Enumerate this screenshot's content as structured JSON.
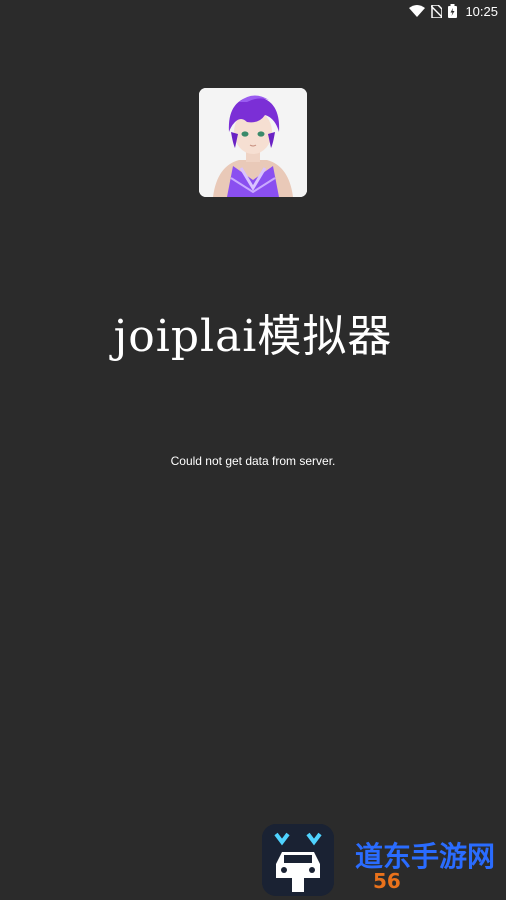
{
  "status_bar": {
    "time": "10:25",
    "icons": [
      "wifi-icon",
      "no-sim-icon",
      "battery-charging-icon"
    ]
  },
  "app": {
    "avatar": "anime-character-avatar",
    "title": "joiplai模拟器",
    "message": "Could not get data from server."
  },
  "footer": {
    "logo": "car-logo-icon",
    "watermark_text": "道东手游网"
  },
  "colors": {
    "background": "#2b2b2b",
    "text": "#ffffff",
    "avatar_hair": "#7b2fd6",
    "logo_bg": "#1a2233",
    "logo_accent": "#4fd3ff"
  }
}
